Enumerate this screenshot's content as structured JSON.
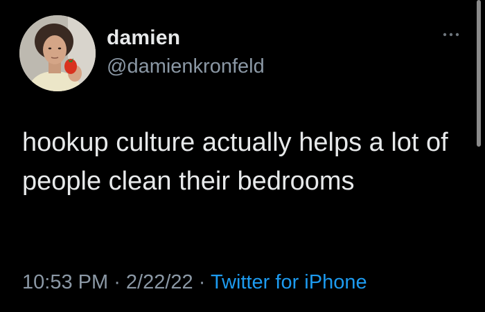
{
  "user": {
    "display_name": "damien",
    "handle": "@damienkronfeld"
  },
  "tweet": {
    "text": "hookup culture actually helps a lot of people clean their bedrooms",
    "time": "10:53 PM",
    "separator_1": " · ",
    "date": "2/22/22",
    "separator_2": " · ",
    "source": "Twitter for iPhone"
  },
  "icons": {
    "more": "more-horizontal-icon",
    "avatar": "profile-photo"
  },
  "colors": {
    "background": "#000000",
    "primary_text": "#e7e9ea",
    "secondary_text": "#8b98a5",
    "link": "#1d9bf0"
  }
}
